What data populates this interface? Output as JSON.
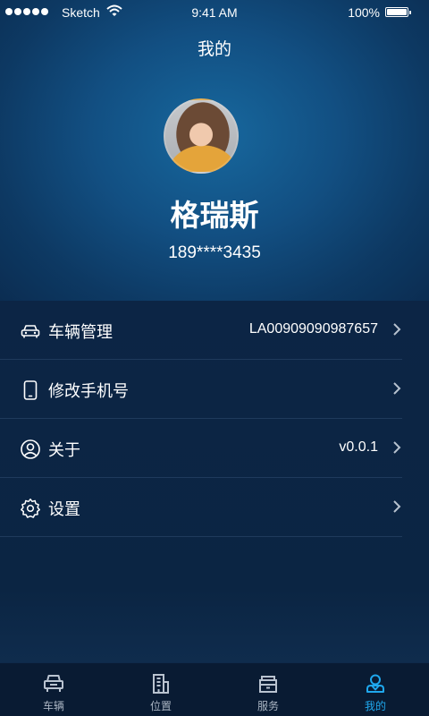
{
  "status_bar": {
    "carrier": "Sketch",
    "time": "9:41 AM",
    "battery": "100%"
  },
  "nav": {
    "title": "我的"
  },
  "profile": {
    "name": "格瑞斯",
    "phone": "189****3435"
  },
  "menu": [
    {
      "icon": "car-icon",
      "label": "车辆管理",
      "value": "LA00909090987657"
    },
    {
      "icon": "phone-icon",
      "label": "修改手机号",
      "value": ""
    },
    {
      "icon": "user-circle-icon",
      "label": "关于",
      "value": "v0.0.1"
    },
    {
      "icon": "gear-icon",
      "label": "设置",
      "value": ""
    }
  ],
  "tabbar": {
    "active": 3,
    "accent_color": "#1fa8ee",
    "tabs": [
      {
        "icon": "vehicle-icon",
        "label": "车辆"
      },
      {
        "icon": "location-building-icon",
        "label": "位置"
      },
      {
        "icon": "service-icon",
        "label": "服务"
      },
      {
        "icon": "profile-icon",
        "label": "我的"
      }
    ]
  }
}
